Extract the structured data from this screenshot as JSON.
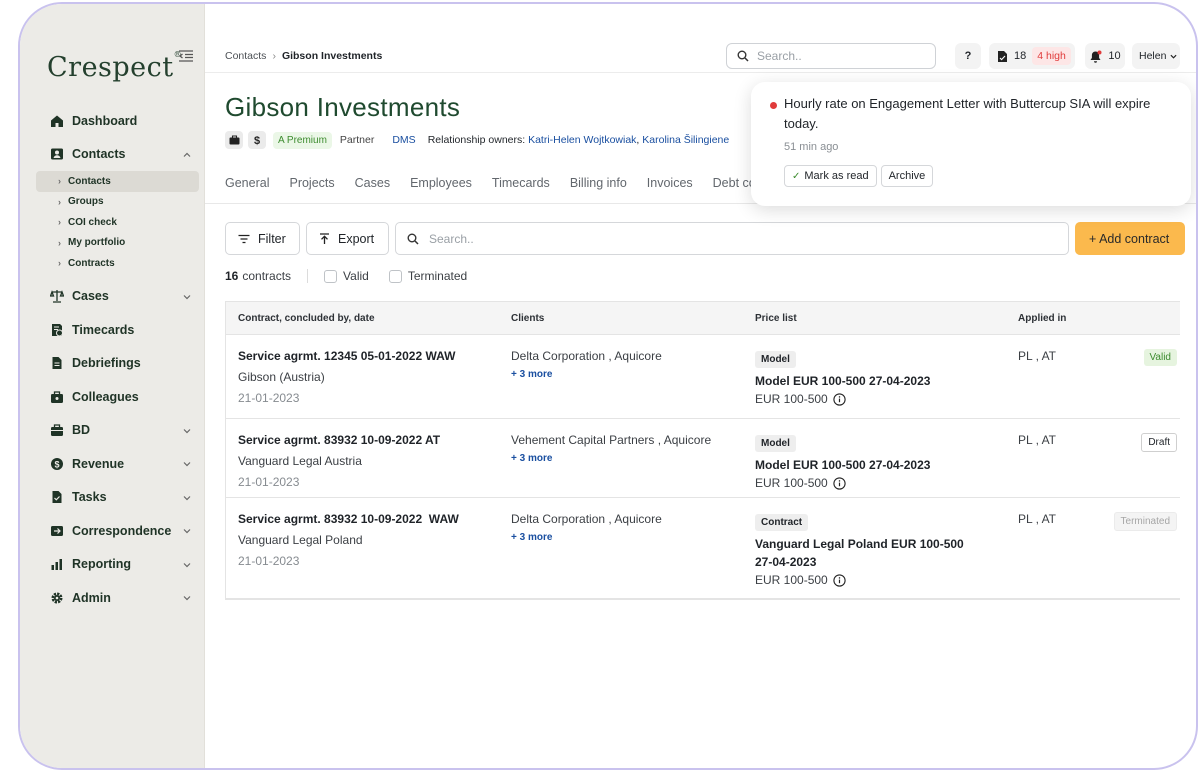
{
  "sidebar": {
    "logo": "Crespect",
    "logo_mark": "®",
    "items": [
      {
        "label": "Dashboard",
        "icon": "home-icon"
      },
      {
        "label": "Contacts",
        "icon": "contacts-icon",
        "expanded": true
      },
      {
        "label": "Cases",
        "icon": "scale-icon"
      },
      {
        "label": "Timecards",
        "icon": "timecard-icon"
      },
      {
        "label": "Debriefings",
        "icon": "document-icon"
      },
      {
        "label": "Colleagues",
        "icon": "briefcase-icon"
      },
      {
        "label": "BD",
        "icon": "bag-icon"
      },
      {
        "label": "Revenue",
        "icon": "dollar-icon"
      },
      {
        "label": "Tasks",
        "icon": "task-icon"
      },
      {
        "label": "Correspondence",
        "icon": "mail-icon"
      },
      {
        "label": "Reporting",
        "icon": "chart-icon"
      },
      {
        "label": "Admin",
        "icon": "gear-icon"
      }
    ],
    "contacts_sub": [
      "Contacts",
      "Groups",
      "COI check",
      "My portfolio",
      "Contracts"
    ]
  },
  "topbar": {
    "breadcrumb": [
      "Contacts",
      "Gibson Investments"
    ],
    "search_placeholder": "Search..",
    "help": "?",
    "tasks_count": "18",
    "tasks_high": "4 high",
    "notifications_count": "10",
    "user": "Helen"
  },
  "header": {
    "title": "Gibson Investments",
    "badge_premium": "A Premium",
    "role": "Partner",
    "dms": "DMS",
    "owners_label": "Relationship owners:",
    "owners": [
      "Katri-Helen Wojtkowiak",
      "Karolina Šilingiene"
    ]
  },
  "tabs": [
    "General",
    "Projects",
    "Cases",
    "Employees",
    "Timecards",
    "Billing info",
    "Invoices",
    "Debt co"
  ],
  "toolbar": {
    "filter": "Filter",
    "export": "Export",
    "search_placeholder": "Search..",
    "add": "+ Add contract"
  },
  "summary": {
    "count": "16",
    "count_label": "contracts",
    "filters": [
      "Valid",
      "Terminated"
    ]
  },
  "table": {
    "headers": [
      "Contract, concluded by, date",
      "Clients",
      "Price list",
      "Applied in"
    ],
    "rows": [
      {
        "title": "Service agrmt. 12345 05-01-2022 WAW",
        "concluded_by": "Gibson (Austria)",
        "date": "21-01-2023",
        "clients": "Delta Corporation , Aquicore",
        "more": "+ 3 more",
        "price_type": "Model",
        "price_name": "Model EUR 100-500 27-04-2023",
        "price_range": "EUR 100-500",
        "applied": "PL , AT",
        "status": "Valid"
      },
      {
        "title": "Service agrmt. 83932 10-09-2022 AT",
        "concluded_by": "Vanguard Legal Austria",
        "date": "21-01-2023",
        "clients": "Vehement Capital Partners , Aquicore",
        "more": "+ 3 more",
        "price_type": "Model",
        "price_name": "Model EUR 100-500 27-04-2023",
        "price_range": "EUR 100-500",
        "applied": "PL , AT",
        "status": "Draft"
      },
      {
        "title": "Service agrmt. 83932 10-09-2022  WAW",
        "concluded_by": "Vanguard Legal Poland",
        "date": "21-01-2023",
        "clients": "Delta Corporation , Aquicore",
        "more": "+ 3 more",
        "price_type": "Contract",
        "price_name": "Vanguard Legal Poland EUR 100-500 27-04-2023",
        "price_range": "EUR 100-500",
        "applied": "PL , AT",
        "status": "Terminated"
      }
    ]
  },
  "toast": {
    "message": "Hourly rate on Engagement Letter with Buttercup SIA will expire today.",
    "time": "51 min ago",
    "mark_read": "Mark as read",
    "archive": "Archive"
  },
  "colors": {
    "brand_green": "#1f4a2f",
    "accent_orange": "#fbb94d",
    "link_blue": "#1a4fa0",
    "alert_red": "#e03b3b",
    "sidebar_bg": "#ecebe7"
  }
}
